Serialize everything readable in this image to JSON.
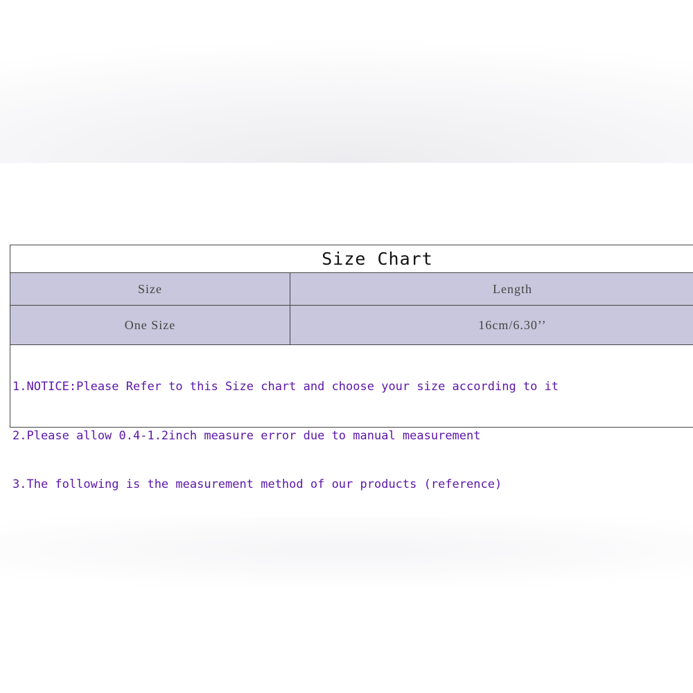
{
  "size_chart": {
    "title": "Size Chart",
    "columns": [
      "Size",
      "Length"
    ],
    "rows": [
      [
        "One Size",
        "16cm/6.30’’"
      ]
    ],
    "notes": [
      "1.NOTICE:Please Refer to this Size chart and choose your size according to it",
      "2.Please allow 0.4-1.2inch measure error due to manual measurement",
      "3.The following is the measurement method of our products (reference)"
    ]
  },
  "colors": {
    "header_fill": "#c9c7dd",
    "notes_text": "#5b16a8",
    "border": "#444444"
  }
}
